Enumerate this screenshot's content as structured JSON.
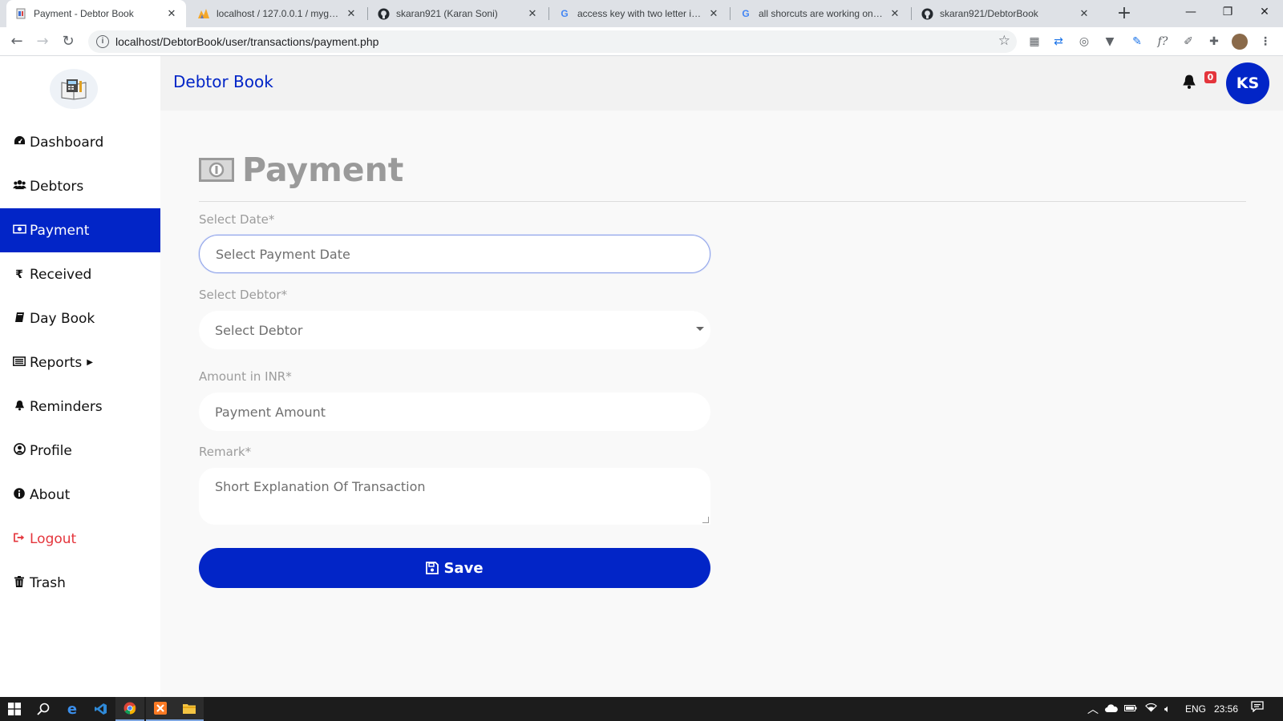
{
  "browser": {
    "tabs": [
      {
        "title": "Payment - Debtor Book",
        "icon": "page-icon",
        "active": true
      },
      {
        "title": "localhost / 127.0.0.1 / mygift / t",
        "icon": "phpmyadmin-icon",
        "active": false
      },
      {
        "title": "skaran921 (Karan Soni)",
        "icon": "github-icon",
        "active": false
      },
      {
        "title": "access key with two letter in ht",
        "icon": "google-icon",
        "active": false
      },
      {
        "title": "all shorcuts are working on chr",
        "icon": "google-icon",
        "active": false
      },
      {
        "title": "skaran921/DebtorBook",
        "icon": "github-icon",
        "active": false
      }
    ],
    "address": "localhost/DebtorBook/user/transactions/payment.php"
  },
  "header": {
    "brand": "Debtor Book",
    "notification_count": "0",
    "avatar_initials": "KS",
    "accent_color": "#0225c7"
  },
  "sidebar": {
    "items": [
      {
        "label": "Dashboard",
        "icon": "dashboard-icon"
      },
      {
        "label": "Debtors",
        "icon": "users-icon"
      },
      {
        "label": "Payment",
        "icon": "money-icon",
        "active": true
      },
      {
        "label": "Received",
        "icon": "rupee-icon"
      },
      {
        "label": "Day Book",
        "icon": "book-icon"
      },
      {
        "label": "Reports",
        "icon": "list-icon"
      },
      {
        "label": "Reminders",
        "icon": "bell-icon"
      },
      {
        "label": "Profile",
        "icon": "user-circle-icon"
      },
      {
        "label": "About",
        "icon": "info-icon"
      },
      {
        "label": "Logout",
        "icon": "sign-out-icon"
      },
      {
        "label": "Trash",
        "icon": "trash-icon"
      }
    ]
  },
  "main": {
    "title": "Payment",
    "form": {
      "date_label": "Select Date*",
      "date_placeholder": "Select Payment Date",
      "debtor_label": "Select Debtor*",
      "debtor_selected": "Select Debtor",
      "amount_label": "Amount in INR*",
      "amount_placeholder": "Payment Amount",
      "remark_label": "Remark*",
      "remark_placeholder": "Short Explanation Of Transaction",
      "save_label": "Save"
    }
  },
  "taskbar": {
    "language": "ENG",
    "time": "23:56"
  }
}
